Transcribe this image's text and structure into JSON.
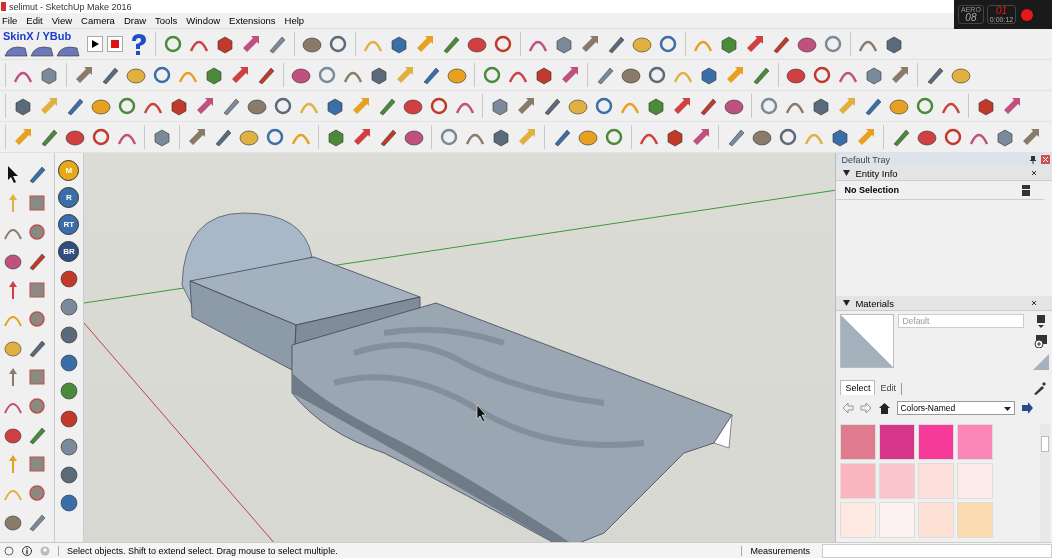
{
  "window": {
    "title": "selimut - SketchUp Make 2016"
  },
  "menu": [
    "File",
    "Edit",
    "View",
    "Camera",
    "Draw",
    "Tools",
    "Window",
    "Extensions",
    "Help"
  ],
  "toolbar": {
    "brand_label": "SkinX / YBub"
  },
  "recorder": {
    "mode": "AERO",
    "fps": "08",
    "clip": "01",
    "time": "0:00:12"
  },
  "palette_badges": [
    {
      "label": "M",
      "color": "#e8a818"
    },
    {
      "label": "R",
      "color": "#3a6ea8"
    },
    {
      "label": "RT",
      "color": "#3a6ea8"
    },
    {
      "label": "BR",
      "color": "#2e4f80"
    }
  ],
  "tray": {
    "title": "Default Tray",
    "entity_info": {
      "title": "Entity Info",
      "expanded": true,
      "selection": "No Selection"
    },
    "materials": {
      "title": "Materials",
      "expanded": true,
      "name_placeholder": "Default",
      "tabs": [
        {
          "label": "Select",
          "selected": true
        },
        {
          "label": "Edit",
          "selected": false
        }
      ],
      "library": "Colors-Named",
      "swatches": [
        {
          "color": "#e07a8e"
        },
        {
          "color": "#d6368a"
        },
        {
          "color": "#f53a9a"
        },
        {
          "color": "#fb86b8"
        },
        {
          "color": "#fbb5bf"
        },
        {
          "color": "#fcc4cc"
        },
        {
          "color": "#fde0dc"
        },
        {
          "color": "#fdebea"
        },
        {
          "color": "#fde8e2"
        },
        {
          "color": "#fdf1f1"
        },
        {
          "color": "#fde1d4"
        },
        {
          "color": "#fddbb0"
        }
      ]
    }
  },
  "status_bar": {
    "hint": "Select objects. Shift to extend select. Drag mouse to select multiple.",
    "measurements_label": "Measurements"
  }
}
